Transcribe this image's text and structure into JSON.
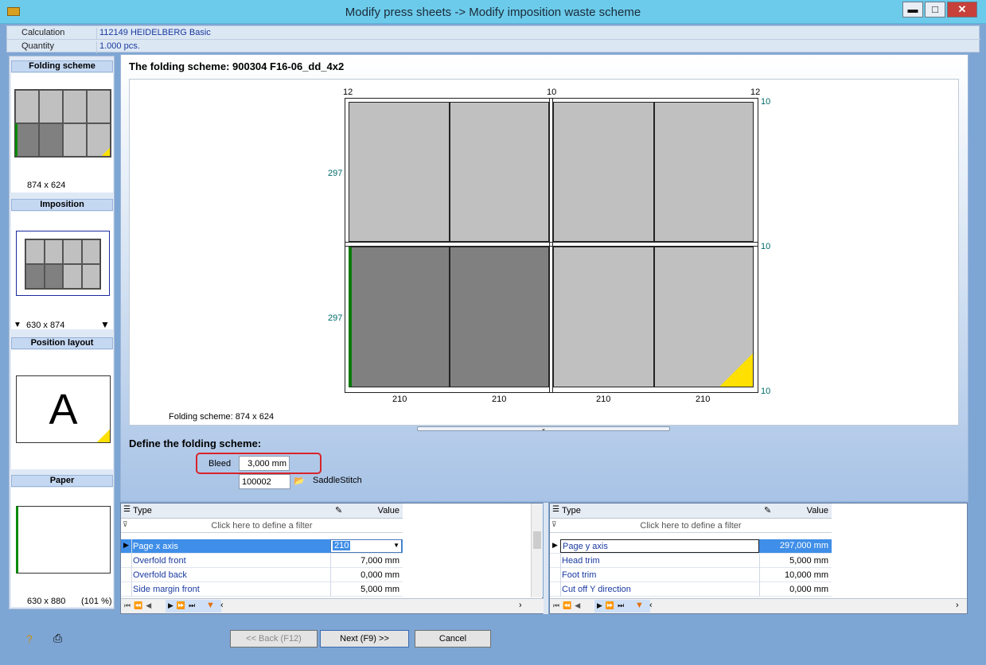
{
  "window": {
    "title": "Modify press sheets -> Modify imposition waste scheme",
    "minimize": "▬",
    "maximize": "□",
    "close": "✕"
  },
  "info": {
    "calculation_label": "Calculation",
    "calculation_value": "112149 HEIDELBERG Basic",
    "quantity_label": "Quantity",
    "quantity_value": "1.000 pcs."
  },
  "sidebar": {
    "folding_title": "Folding scheme",
    "folding_size": "874 x 624",
    "imposition_title": "Imposition",
    "imposition_size": "630 x 874",
    "position_title": "Position layout",
    "position_letter": "A",
    "paper_title": "Paper",
    "paper_size": "630 x 880",
    "paper_pct": "(101 %)"
  },
  "main": {
    "heading": "The folding scheme: 900304 F16-06_dd_4x2",
    "top_dims": [
      "12",
      "10",
      "12"
    ],
    "right_dims": [
      "10",
      "10",
      "10"
    ],
    "left_dims": [
      "297",
      "297"
    ],
    "bottom_dims": [
      "210",
      "210",
      "210",
      "210"
    ],
    "caption": "Folding scheme: 874 x 624",
    "define_heading": "Define the folding scheme:",
    "bleed_label": "Bleed",
    "bleed_value": "3,000 mm",
    "code_value": "100002",
    "binding_label": "SaddleStitch"
  },
  "left_table": {
    "type_header": "Type",
    "value_header": "Value",
    "filter_text": "Click here to define a filter",
    "rows": [
      {
        "type": "Page x axis",
        "value": "210"
      },
      {
        "type": "Overfold front",
        "value": "7,000 mm"
      },
      {
        "type": "Overfold back",
        "value": "0,000 mm"
      },
      {
        "type": "Side margin front",
        "value": "5,000 mm"
      }
    ]
  },
  "right_table": {
    "type_header": "Type",
    "value_header": "Value",
    "filter_text": "Click here to define a filter",
    "rows": [
      {
        "type": "Page y axis",
        "value": "297,000 mm"
      },
      {
        "type": "Head trim",
        "value": "5,000 mm"
      },
      {
        "type": "Foot trim",
        "value": "10,000 mm"
      },
      {
        "type": "Cut off Y direction",
        "value": "0,000 mm"
      }
    ]
  },
  "buttons": {
    "back": "<< Back (F12)",
    "next": "Next (F9) >>",
    "cancel": "Cancel"
  }
}
